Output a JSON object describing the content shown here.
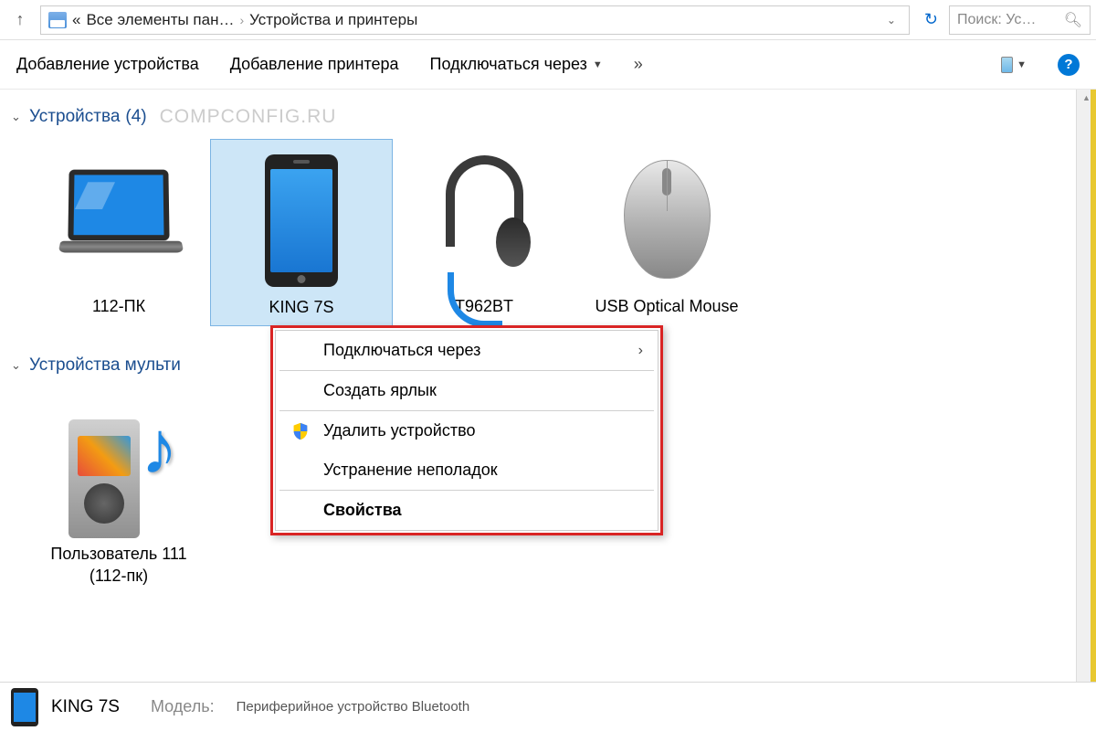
{
  "nav": {
    "breadcrumb_prefix": "«",
    "breadcrumb_item1": "Все элементы пан…",
    "breadcrumb_item2": "Устройства и принтеры",
    "search_placeholder": "Поиск: Ус…"
  },
  "toolbar": {
    "add_device": "Добавление устройства",
    "add_printer": "Добавление принтера",
    "connect_via": "Подключаться через",
    "more": "»"
  },
  "groups": {
    "devices": {
      "title": "Устройства",
      "count": "(4)",
      "watermark": "COMPCONFIG.RU"
    },
    "multimedia": {
      "title": "Устройства мульти"
    }
  },
  "devices": [
    {
      "label": "112-ПК"
    },
    {
      "label": "KING 7S"
    },
    {
      "label": "T962BT"
    },
    {
      "label": "USB Optical Mouse"
    }
  ],
  "multimedia_devices": [
    {
      "label": "Пользователь 111 (112-пк)"
    }
  ],
  "context_menu": {
    "connect_via": "Подключаться через",
    "create_shortcut": "Создать ярлык",
    "remove_device": "Удалить устройство",
    "troubleshoot": "Устранение неполадок",
    "properties": "Свойства"
  },
  "details": {
    "name": "KING 7S",
    "model_label": "Модель:",
    "model_value": "Периферийное устройство Bluetooth"
  }
}
